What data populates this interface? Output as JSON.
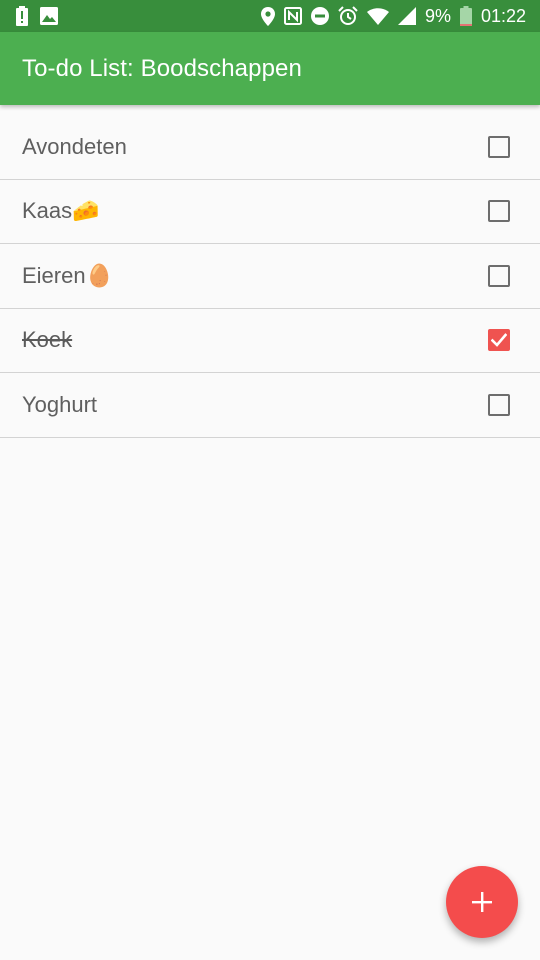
{
  "status_bar": {
    "battery_percent": "9%",
    "time": "01:22",
    "icons_left": [
      "battery-alert-icon",
      "image-icon"
    ],
    "icons_right": [
      "location-icon",
      "nfc-icon",
      "do-not-disturb-icon",
      "alarm-icon",
      "wifi-icon",
      "cell-signal-icon",
      "battery-icon"
    ]
  },
  "app_bar": {
    "title": "To-do List: Boodschappen"
  },
  "todo_items": [
    {
      "label": "Avondeten",
      "checked": false
    },
    {
      "label": "Kaas🧀",
      "checked": false
    },
    {
      "label": "Eieren🥚",
      "checked": false
    },
    {
      "label": "Koek",
      "checked": true
    },
    {
      "label": "Yoghurt",
      "checked": false
    }
  ],
  "fab": {
    "icon": "plus-icon"
  },
  "colors": {
    "status_bar": "#388e3c",
    "app_bar": "#4caf50",
    "accent": "#f44c4c",
    "background": "#fafafa"
  }
}
